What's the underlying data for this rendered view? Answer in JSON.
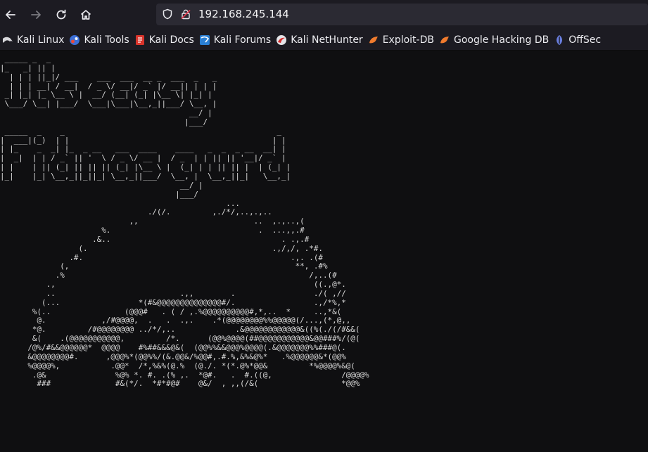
{
  "toolbar": {
    "url": "192.168.245.144"
  },
  "bookmarks": [
    {
      "label": "Kali Linux",
      "icon": "kali-dragon-icon"
    },
    {
      "label": "Kali Tools",
      "icon": "kali-tools-icon"
    },
    {
      "label": "Kali Docs",
      "icon": "kali-docs-icon"
    },
    {
      "label": "Kali Forums",
      "icon": "kali-forums-icon"
    },
    {
      "label": "Kali NetHunter",
      "icon": "kali-nethunter-icon"
    },
    {
      "label": "Exploit-DB",
      "icon": "exploit-db-icon"
    },
    {
      "label": "Google Hacking DB",
      "icon": "google-hacking-db-icon"
    },
    {
      "label": "OffSec",
      "icon": "offsec-icon"
    }
  ],
  "page": {
    "ascii_art": " _____ _  _\n|_   _| || |\n  | | | ||_|/ ___    ___  ___  __ _  ___  _   _\n  | | | __| / __|  / _ \\/ __|/ _` |/ __|| | | |\n _| |_| |_ \\__ \\ |  __/ (__| (_| |\\__ \\| |_| |\n \\___/ \\__| |___/  \\___|\\___|\\__,_||___/ \\__, |\n                                         __/ |\n                                        |___/\n _____  _    _                                              _\n|  ___|(_)  | |                                            | |\n| |_    _  _| |_  _ __   ___  ____    ____   _  _  _ __  __| |\n|  _|  | | / _` || '  \\ / _ \\/ __ |  / _  | | || || '__|/ _` |\n| |    | || (_| || || || (_| |\\__ \\ |  (_| | | || || |  | (_| |\n|_|    |_| \\__,_||_||_| \\__,_||___/  \\__, |  \\__,_||_|   \\__,_|\n                                       __/ |\n                                      |___/\n                                                 ...\n                                ./(/.         ,./*/,..,.,..\n                            ,,                         ..  ,.,..,(\n                      %.                                .  ...,,.#\n                    .&..                                     . .,.#\n                 (.                                        .,/,/, .*#.\n               .#.                                             .,. .(#\n             (,                                                 **, .#%\n            .%                                                     /,..(#\n          .,                                                        ((.,@*.\n          ..                           .,,        .                 ./( ,//\n         (...                 *(#&@@@@@@@@@@@@@@#/.                 .,/*%,*\n       %(..                (@@@#   . ( / ,.%@@@@@@@@@@#,*,..  *     ..,*&(\n        @.            ,/#@@@@,  .   .  .,.    .*(@@@@@@@@%%@@@@@(/...,(*,@,,\n       *@.         /#@@@@@@@@ ../*/,..             .&@@@@@@@@@@@@&((%(./(/#&&(\n       &(    .(@@@@@@@@@@@,         /*.      (@@%@@@@(##@@@@@@@@@@@&@@###%/(@(\n      /@%/#&&@@@@@@*  @@@@    #%##&&&@&(  (@@%%&&@@@%@@@@(.&@@@@@@@%%###@(.\n      &@@@@@@@@#.      ,@@@%*(@@%%/(&.@@&/%@@#,.#.%,&%&@%*   .%@@@@@@&*(@@%\n      %@@@@%,           .@@*  /*,%&%(@.%  (@./. *(*.@%*@@&         *%@@@@%&@(\n       .@&               %@% *. #. .(% ,.  *@#.   .  #.((@,               /@@@@%\n        ###              #&(*/.  *#*#@#    @&/  , ,,(/&(                  *@@%"
  }
}
